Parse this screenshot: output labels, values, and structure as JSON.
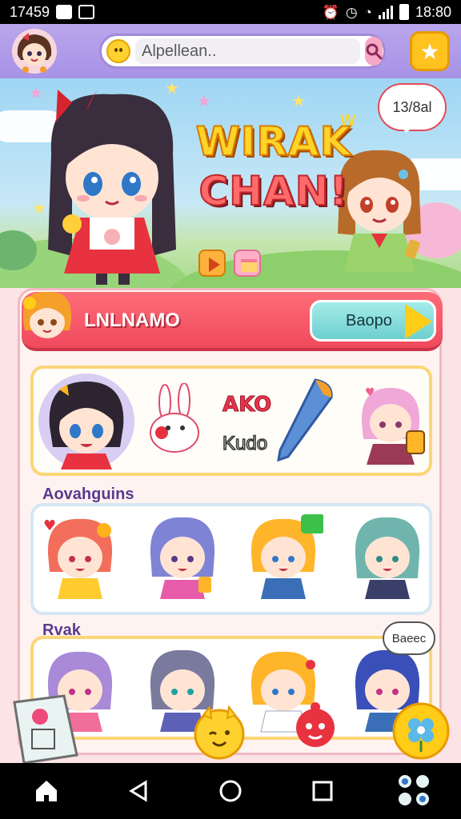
{
  "status_bar": {
    "time_left": "17459",
    "time_right": "18:80"
  },
  "header": {
    "search_placeholder": "Alpellean..",
    "avatar_icon": "avatar",
    "star_icon": "star-icon"
  },
  "hero": {
    "title_line1": "WIRAK",
    "title_line2": "CHAN!",
    "bubble_text": "13/8al"
  },
  "section": {
    "title": "LNLNAMO",
    "button_label": "Baopo"
  },
  "featured": {
    "label1": "AKO",
    "label2": "Kudo"
  },
  "rows": [
    {
      "label": "Aovahguins"
    },
    {
      "label": "Rvak",
      "badge_text": "Baeec"
    }
  ],
  "colors": {
    "accent_red": "#ef4a5c",
    "accent_purple": "#a792e6",
    "accent_yellow": "#ffc21f",
    "accent_teal": "#6dcfcf"
  }
}
